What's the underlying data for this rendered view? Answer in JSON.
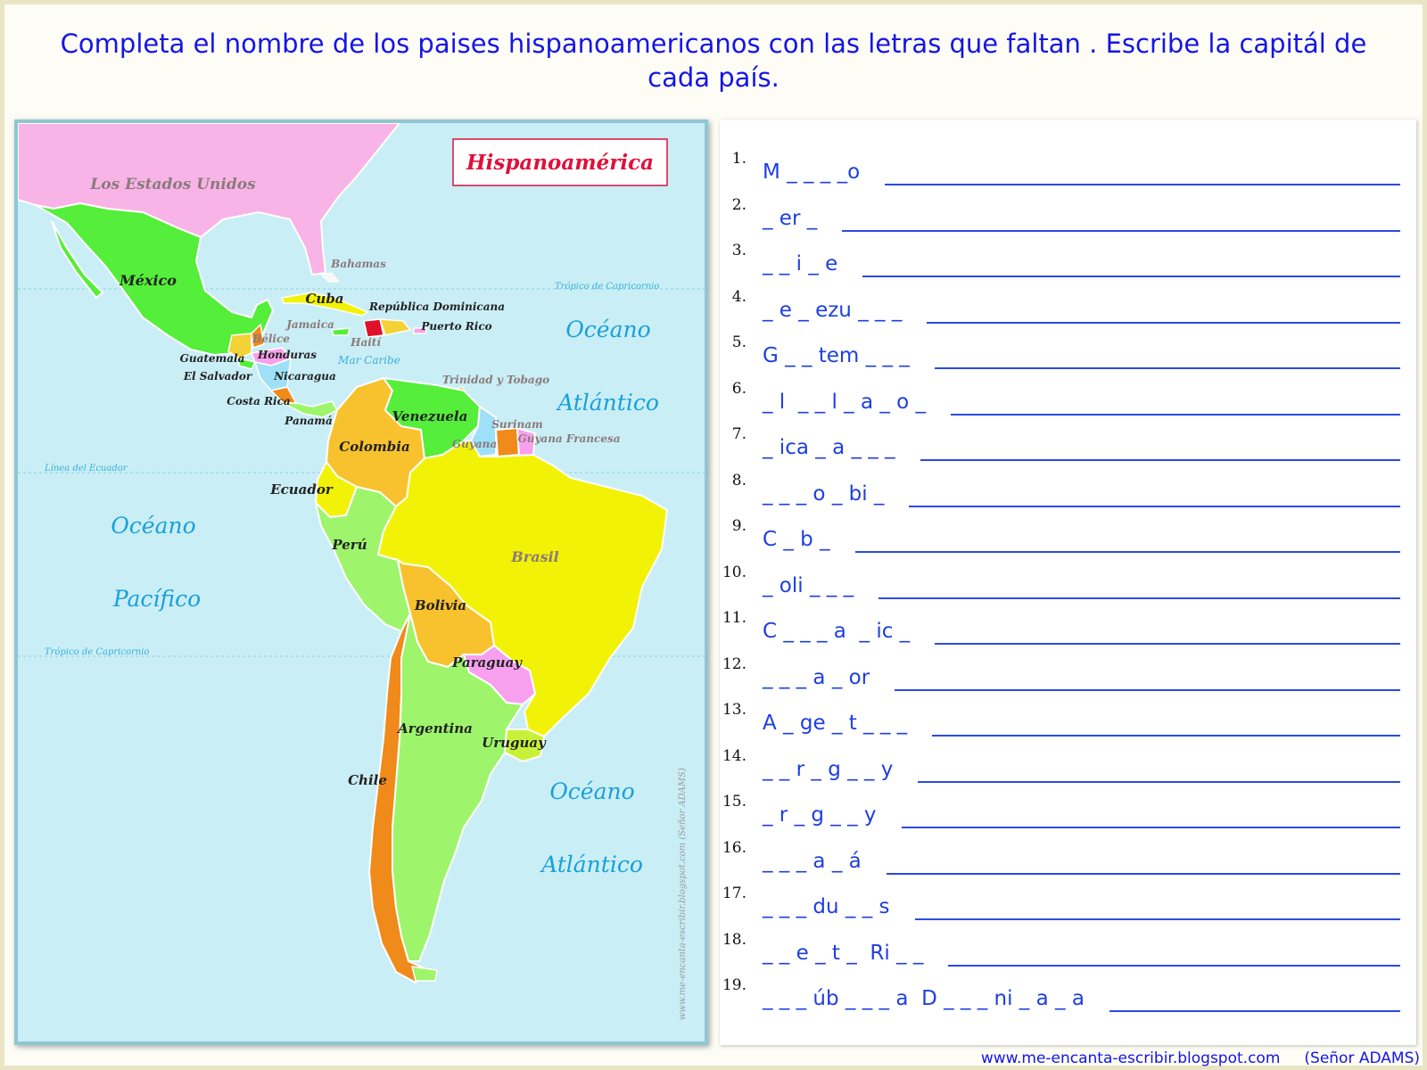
{
  "instructions": "Completa el nombre de los paises hispanoamericanos con las letras que faltan . Escribe la capitál de cada país.",
  "map": {
    "title": "Hispanoamérica",
    "credit": "www.me-encanta-escribir.blogspot.com     (Señor ADAMS)",
    "labels": {
      "usa": "Los Estados Unidos",
      "mexico": "México",
      "bahamas": "Bahamas",
      "cuba": "Cuba",
      "rep_dom": "República Dominicana",
      "puerto_rico": "Puerto Rico",
      "jamaica": "Jamaica",
      "haiti": "Haití",
      "belice": "Bélice",
      "guatemala": "Guatemala",
      "honduras": "Honduras",
      "el_salvador": "El Salvador",
      "nicaragua": "Nicaragua",
      "mar_caribe": "Mar Caribe",
      "costa_rica": "Costa Rica",
      "panama": "Panamá",
      "trinidad": "Trinidad y Tobago",
      "venezuela": "Venezuela",
      "surinam": "Surinam",
      "guyana": "Guyana",
      "guyana_francesa": "Guyana Francesa",
      "colombia": "Colombia",
      "ecuador": "Ecuador",
      "peru": "Perú",
      "brasil": "Brasil",
      "bolivia": "Bolivia",
      "paraguay": "Paraguay",
      "argentina": "Argentina",
      "uruguay": "Uruguay",
      "chile": "Chile",
      "tropico_top": "Trópico de Capricornio",
      "tropico_bottom": "Trópico de Capricornio",
      "ecuador_line": "Línea del Ecuador",
      "oceano_atl1": "Océano",
      "atlantico1": "Atlántico",
      "oceano_pac": "Océano",
      "pacifico": "Pacífico",
      "oceano_atl2": "Océano",
      "atlantico2": "Atlántico"
    }
  },
  "questions": [
    {
      "num": "1.",
      "word": "M _ _ _ _o"
    },
    {
      "num": "2.",
      "word": "_ er _"
    },
    {
      "num": "3.",
      "word": "_ _ i _ e"
    },
    {
      "num": "4.",
      "word": "_ e _ ezu _ _ _"
    },
    {
      "num": "5.",
      "word": "G _ _ tem _ _ _"
    },
    {
      "num": "6.",
      "word": "_ l  _ _ l _ a _ o _"
    },
    {
      "num": "7.",
      "word": "_ ica _ a _ _ _"
    },
    {
      "num": "8.",
      "word": "_ _ _ o _ bi _"
    },
    {
      "num": "9.",
      "word": "C _ b _"
    },
    {
      "num": "10.",
      "word": "_ oli _ _ _"
    },
    {
      "num": "11.",
      "word": "C _ _ _ a  _ ic _"
    },
    {
      "num": "12.",
      "word": "_ _ _ a _ or"
    },
    {
      "num": "13.",
      "word": "A _ ge _ t _ _ _"
    },
    {
      "num": "14.",
      "word": "_ _ r _ g _ _ y"
    },
    {
      "num": "15.",
      "word": "_ r _ g _ _ y"
    },
    {
      "num": "16.",
      "word": "_ _ _ a _ á"
    },
    {
      "num": "17.",
      "word": "_ _ _ du _ _ s"
    },
    {
      "num": "18.",
      "word": "_ _ e _ t _  Ri _ _"
    },
    {
      "num": "19.",
      "word": "_ _ _ úb _ _ _ a  D _ _ _ ni _ a _ a"
    }
  ],
  "footer": "www.me-encanta-escribir.blogspot.com     (Señor ADAMS)"
}
